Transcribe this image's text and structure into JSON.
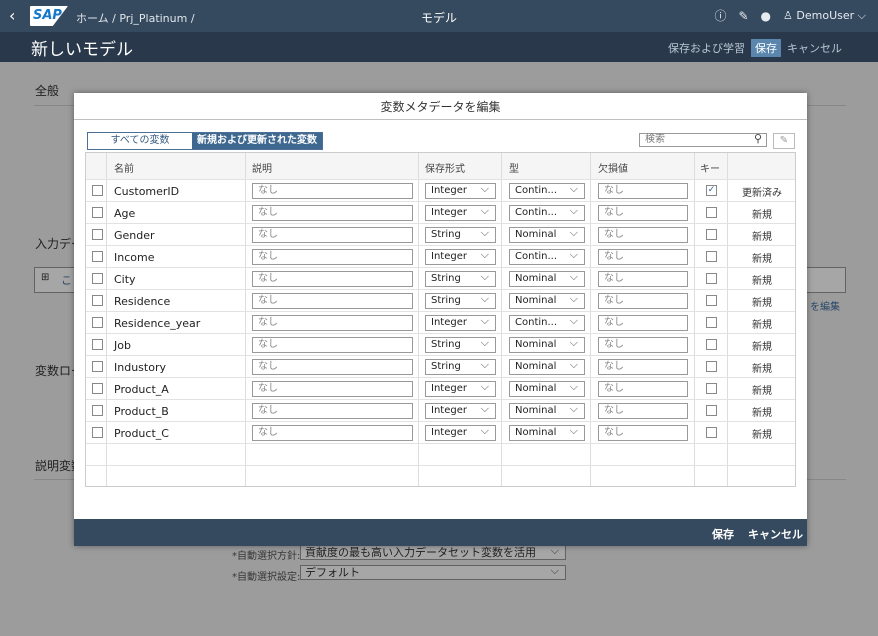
{
  "shell": {
    "back_icon": "chevron-left-icon",
    "logo_text": "SAP",
    "breadcrumb": "ホーム / Prj_Platinum /",
    "title": "モデル",
    "user": "DemoUser"
  },
  "subheader": {
    "title": "新しいモデル",
    "save_and_train": "保存および学習",
    "save": "保存",
    "cancel": "キャンセル"
  },
  "background": {
    "section_general": "全般",
    "section_input": "入力デー",
    "edit_link": "を編集",
    "section_var_role": "変数ロー",
    "section_explanatory": "説明変数",
    "auto_select_label": "*自動選択方針:",
    "auto_select_value": "貢献度の最も高い入力データセット変数を活用",
    "auto_setting_label": "*自動選択設定:",
    "auto_setting_value": "デフォルト",
    "input_box_prefix": "こ"
  },
  "dialog": {
    "title": "変数メタデータを編集",
    "tab_all": "すべての変数",
    "tab_new": "新規および更新された変数",
    "search_placeholder": "検索",
    "columns": {
      "name": "名前",
      "description": "説明",
      "storage": "保存形式",
      "type": "型",
      "missing": "欠損値",
      "key": "キー"
    },
    "rows": [
      {
        "name": "CustomerID",
        "desc": "なし",
        "storage": "Integer",
        "type": "Contin...",
        "missing": "なし",
        "key": true,
        "status": "更新済み"
      },
      {
        "name": "Age",
        "desc": "なし",
        "storage": "Integer",
        "type": "Contin...",
        "missing": "なし",
        "key": false,
        "status": "新規"
      },
      {
        "name": "Gender",
        "desc": "なし",
        "storage": "String",
        "type": "Nominal",
        "missing": "なし",
        "key": false,
        "status": "新規"
      },
      {
        "name": "Income",
        "desc": "なし",
        "storage": "Integer",
        "type": "Contin...",
        "missing": "なし",
        "key": false,
        "status": "新規"
      },
      {
        "name": "City",
        "desc": "なし",
        "storage": "String",
        "type": "Nominal",
        "missing": "なし",
        "key": false,
        "status": "新規"
      },
      {
        "name": "Residence",
        "desc": "なし",
        "storage": "String",
        "type": "Nominal",
        "missing": "なし",
        "key": false,
        "status": "新規"
      },
      {
        "name": "Residence_year",
        "desc": "なし",
        "storage": "Integer",
        "type": "Contin...",
        "missing": "なし",
        "key": false,
        "status": "新規"
      },
      {
        "name": "Job",
        "desc": "なし",
        "storage": "String",
        "type": "Nominal",
        "missing": "なし",
        "key": false,
        "status": "新規"
      },
      {
        "name": "Industory",
        "desc": "なし",
        "storage": "String",
        "type": "Nominal",
        "missing": "なし",
        "key": false,
        "status": "新規"
      },
      {
        "name": "Product_A",
        "desc": "なし",
        "storage": "Integer",
        "type": "Nominal",
        "missing": "なし",
        "key": false,
        "status": "新規"
      },
      {
        "name": "Product_B",
        "desc": "なし",
        "storage": "Integer",
        "type": "Nominal",
        "missing": "なし",
        "key": false,
        "status": "新規"
      },
      {
        "name": "Product_C",
        "desc": "なし",
        "storage": "Integer",
        "type": "Nominal",
        "missing": "なし",
        "key": false,
        "status": "新規"
      }
    ],
    "footer_save": "保存",
    "footer_cancel": "キャンセル"
  }
}
